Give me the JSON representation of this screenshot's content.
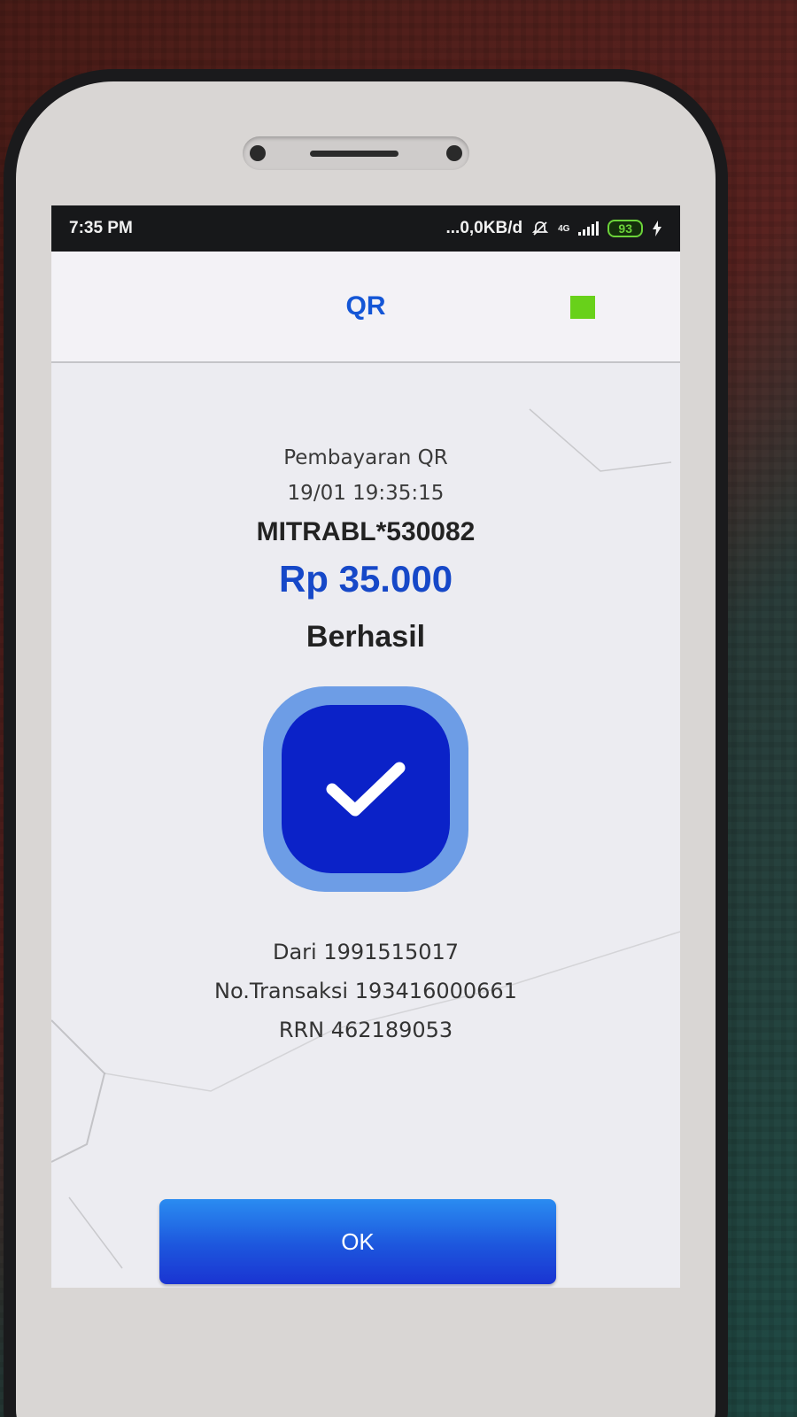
{
  "status_bar": {
    "time": "7:35 PM",
    "network_speed": "...0,0KB/d",
    "network_type": "4G",
    "battery": "93"
  },
  "header": {
    "title": "QR"
  },
  "receipt": {
    "payment_type": "Pembayaran QR",
    "datetime": "19/01 19:35:15",
    "merchant": "MITRABL*530082",
    "amount": "Rp 35.000",
    "status": "Berhasil",
    "from": "Dari 1991515017",
    "transaction_no": "No.Transaksi 193416000661",
    "rrn": "RRN 462189053"
  },
  "actions": {
    "ok_label": "OK"
  },
  "colors": {
    "accent": "#1456d6",
    "amount": "#1648c8",
    "check_outer": "#6d9de6",
    "check_inner": "#0b22c8",
    "status_square": "#68d11a"
  },
  "icons": {
    "success": "checkmark-icon",
    "mute": "bell-off-icon",
    "signal": "signal-icon",
    "battery": "battery-icon",
    "charging": "lightning-icon"
  }
}
